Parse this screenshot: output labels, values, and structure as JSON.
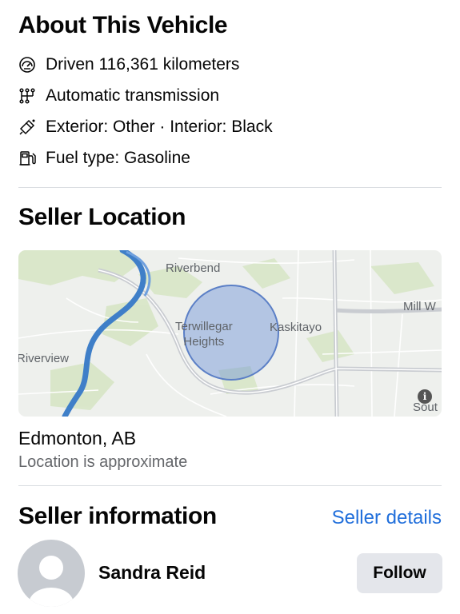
{
  "about": {
    "title": "About This Vehicle",
    "features": [
      {
        "icon": "speedometer-icon",
        "text": "Driven 116,361 kilometers"
      },
      {
        "icon": "transmission-icon",
        "text": "Automatic transmission"
      },
      {
        "icon": "paint-sprayer-icon",
        "text": "Exterior: Other · Interior: Black"
      },
      {
        "icon": "fuel-pump-icon",
        "text": "Fuel type: Gasoline"
      }
    ]
  },
  "location": {
    "title": "Seller Location",
    "map_labels": {
      "riverbend": "Riverbend",
      "terwillegar": "Terwillegar\nHeights",
      "kaskitayo": "Kaskitayo",
      "mill": "Mill W",
      "riverview": "Riverview",
      "south": "Sout"
    },
    "city": "Edmonton, AB",
    "note": "Location is approximate"
  },
  "seller": {
    "title": "Seller information",
    "details_link": "Seller details",
    "name": "Sandra Reid",
    "follow_label": "Follow"
  },
  "colors": {
    "link": "#216fdb",
    "radius_fill": "#6b90d6",
    "river": "#3f7fc8"
  }
}
